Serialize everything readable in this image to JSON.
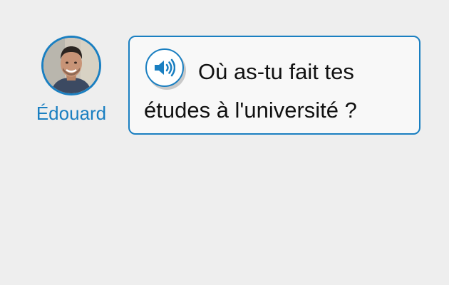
{
  "speaker": {
    "name": "Édouard"
  },
  "prompt": {
    "text": "Où as-tu fait tes études à l'université ?",
    "audio_icon": "speaker-volume-icon"
  },
  "colors": {
    "accent": "#1a7fc1",
    "background": "#eeeeee",
    "bubble_background": "#f8f8f8",
    "text": "#111111"
  }
}
